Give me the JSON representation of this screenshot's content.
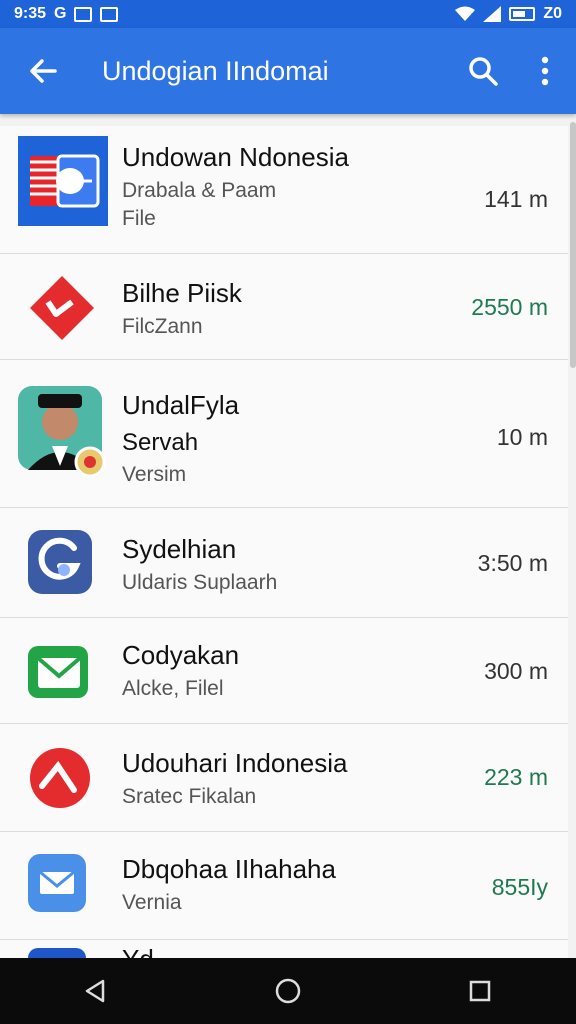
{
  "status_bar": {
    "time": "9:35",
    "right_text": "Z0",
    "icons": [
      "g-icon",
      "notification-box-icon",
      "image-icon",
      "wifi-icon",
      "signal-icon",
      "battery-icon"
    ]
  },
  "app_bar": {
    "title": "Undogian IIndomai",
    "back_icon": "arrow-left-icon",
    "search_icon": "search-icon",
    "menu_icon": "more-vert-icon",
    "color": "#2f74e3"
  },
  "items": [
    {
      "title": "Undowan Ndonesia",
      "subtitle": "Drabala & Paam",
      "subtitle2": "File",
      "meta": "141 m",
      "icon": "flag-chat-app-icon"
    },
    {
      "title": "Bilhe Piisk",
      "subtitle": "FilcZann",
      "meta": "2550 m",
      "icon": "red-play-icon"
    },
    {
      "title": "UndalFyla",
      "subtitle": "Servah",
      "subtitle2": "Versim",
      "meta": "10 m",
      "icon": "profile-avatar-icon"
    },
    {
      "title": "Sydelhian",
      "subtitle": "Uldaris Suplaarh",
      "meta": "3:50 m",
      "icon": "g-app-icon"
    },
    {
      "title": "Codyakan",
      "subtitle": "Alcke, Filel",
      "meta": "300 m",
      "icon": "green-mail-icon"
    },
    {
      "title": "Udouhari Indonesia",
      "subtitle": "Sratec Fikalan",
      "meta": "223 m",
      "icon": "red-slash-icon"
    },
    {
      "title": "Dbqohaa IIhahaha",
      "subtitle": "Vernia",
      "meta": "855Iy",
      "icon": "blue-mail-icon"
    },
    {
      "title": "Yd",
      "subtitle": "",
      "meta": "",
      "icon": "blue-app-icon"
    }
  ],
  "nav": {
    "back": "triangle-back-icon",
    "home": "circle-home-icon",
    "recents": "square-recents-icon"
  }
}
